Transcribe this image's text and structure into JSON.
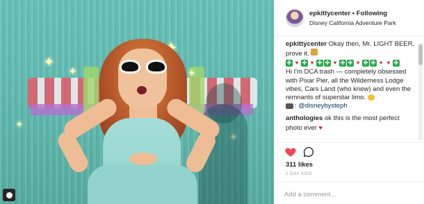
{
  "post": {
    "username": "epkittycenter",
    "separator": "•",
    "follow_status": "Following",
    "location": "Disney California Adventure Park"
  },
  "caption": {
    "username": "epkittycenter",
    "line1": "Okay then, Mr. LIGHT BEER, prove it.",
    "body": "Hi I'm DCA trash — completely obsessed with Pixar Pier, all the Wilderness Lodge vibes, Cars Land (who knew) and even the remnants of superstar limo.",
    "credit_handle": "@disneybysteph"
  },
  "comments": [
    {
      "username": "anthologies",
      "text": "ok this is the most perfect photo ever"
    }
  ],
  "likes_label": "311 likes",
  "timestamp": "1 DAY AGO",
  "add_comment_placeholder": "Add a comment...",
  "icons": {
    "like": "heart-icon",
    "comment": "comment-bubble-icon",
    "user_tag": "user-tag-icon"
  },
  "colors": {
    "like_heart": "#ed4956",
    "link": "#003569",
    "text": "#262626",
    "muted": "#999999"
  }
}
